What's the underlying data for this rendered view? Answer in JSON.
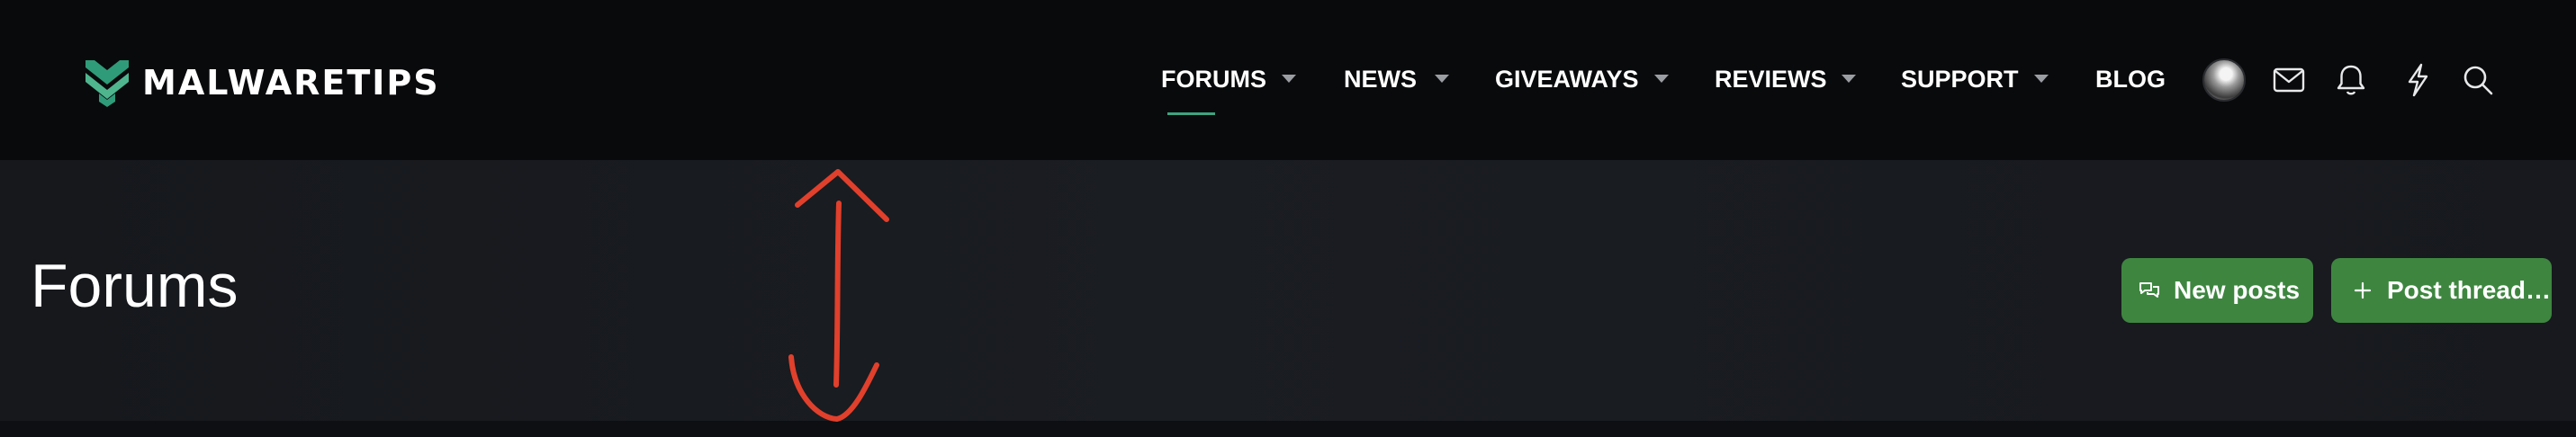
{
  "brand": {
    "name": "MALWARETIPS",
    "accent_color": "#3da37e",
    "logo_icon": "shield-m-logo-icon"
  },
  "nav": {
    "items": [
      {
        "label": "FORUMS",
        "has_dropdown": true,
        "active": true
      },
      {
        "label": "NEWS",
        "has_dropdown": true
      },
      {
        "label": "GIVEAWAYS",
        "has_dropdown": true
      },
      {
        "label": "REVIEWS",
        "has_dropdown": true
      },
      {
        "label": "SUPPORT",
        "has_dropdown": true
      },
      {
        "label": "BLOG",
        "has_dropdown": false
      }
    ],
    "icons": [
      "avatar",
      "envelope-icon",
      "bell-icon",
      "lightning-icon",
      "search-icon"
    ]
  },
  "page": {
    "title": "Forums"
  },
  "actions": {
    "new_posts": "New posts",
    "post_thread": "Post thread…",
    "button_color": "#3e8640"
  },
  "annotation": {
    "type": "double-headed-arrow",
    "color": "#e0402c"
  }
}
